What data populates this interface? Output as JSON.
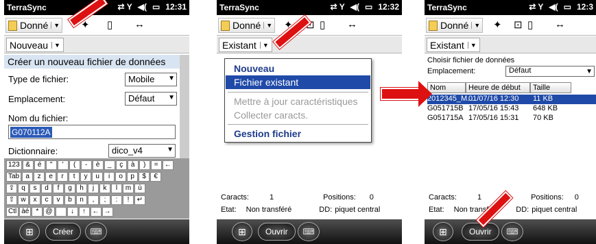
{
  "status": {
    "time1": "12:31",
    "time2": "12:32",
    "time3": "12:3"
  },
  "app_title": "TerraSync",
  "panel1": {
    "data_menu": "Donné",
    "mode_button": "Nouveau",
    "section_title": "Créer un nouveau fichier de données",
    "file_type_label": "Type de fichier:",
    "file_type_value": "Mobile",
    "location_label": "Emplacement:",
    "location_value": "Défaut",
    "filename_label": "Nom du fichier:",
    "filename_value": "G070112A",
    "dictionary_label": "Dictionnaire:",
    "dictionary_value": "dico_v4",
    "keyboard_rows": [
      [
        "123",
        "&",
        "é",
        "\"",
        "'",
        "(",
        "-",
        "è",
        "_",
        "ç",
        "à",
        ")",
        "=",
        "←"
      ],
      [
        "Tab",
        "a",
        "z",
        "e",
        "r",
        "t",
        "y",
        "u",
        "i",
        "o",
        "p",
        "$",
        "€"
      ],
      [
        "⇪",
        "q",
        "s",
        "d",
        "f",
        "g",
        "h",
        "j",
        "k",
        "l",
        "m",
        "ù"
      ],
      [
        "⇧",
        "w",
        "x",
        "c",
        "v",
        "b",
        "n",
        ",",
        ";",
        ":",
        "!",
        "↵"
      ],
      [
        "Ctl",
        "àé",
        "*",
        "@",
        " ",
        "↓",
        "↑",
        "←",
        "→"
      ]
    ],
    "softkey": "Créer"
  },
  "panel2": {
    "data_menu": "Donné",
    "mode_button": "Existant",
    "menu_items": {
      "new": "Nouveau",
      "existing": "Fichier existant",
      "update": "Mettre à jour caractéristiques",
      "collect": "Collecter caracts.",
      "manage": "Gestion fichier"
    },
    "caracts_label": "Caracts:",
    "caracts_value": "1",
    "positions_label": "Positions:",
    "positions_value": "0",
    "etat_label": "Etat:",
    "etat_value": "Non transféré",
    "dd_label": "DD:",
    "dd_value": "piquet central",
    "softkey": "Ouvrir"
  },
  "panel3": {
    "data_menu": "Donné",
    "mode_button": "Existant",
    "choose_label": "Choisir fichier de données",
    "location_label": "Emplacement:",
    "location_value": "Défaut",
    "columns": [
      "Nom",
      "Heure de début",
      "Taille"
    ],
    "rows": [
      [
        "2012345_M...",
        "01/07/16 12:30",
        "11 KB"
      ],
      [
        "G051715B",
        "17/05/16 15:43",
        "648 KB"
      ],
      [
        "G051715A",
        "17/05/16 15:31",
        "70 KB"
      ]
    ],
    "caracts_label": "Caracts:",
    "caracts_value": "1",
    "positions_label": "Positions:",
    "positions_value": "0",
    "etat_label": "Etat:",
    "etat_value": "Non transféré",
    "dd_label": "DD:",
    "dd_value": "piquet central",
    "softkey": "Ouvrir"
  }
}
